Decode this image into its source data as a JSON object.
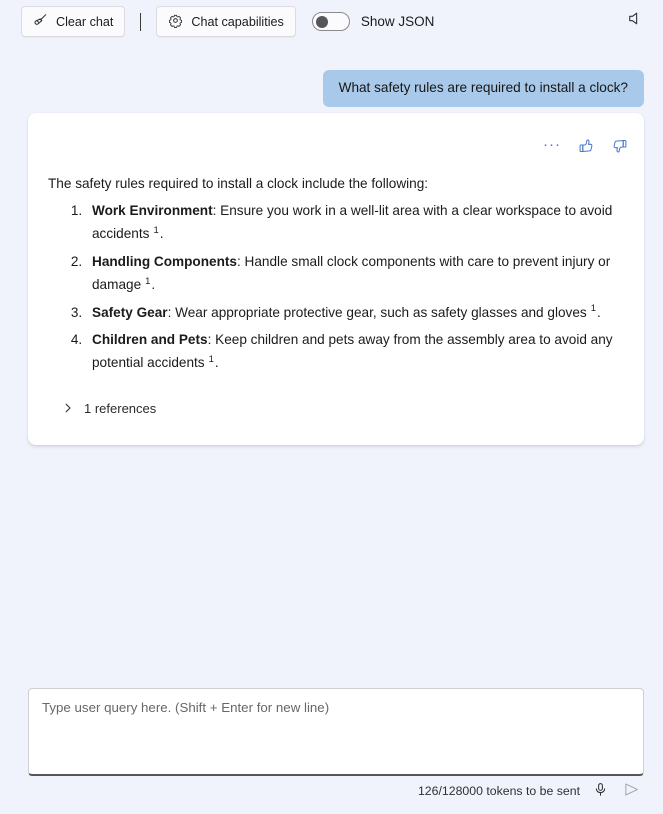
{
  "toolbar": {
    "clear_chat_label": "Clear chat",
    "clear_chat_icon": "broom-icon",
    "chat_capabilities_label": "Chat capabilities",
    "chat_capabilities_icon": "gear-icon",
    "show_json_label": "Show JSON",
    "show_json_enabled": false,
    "speaker_icon": "speaker-mute-icon"
  },
  "conversation": {
    "user_message": "What safety rules are required to install a clock?",
    "assistant": {
      "actions": {
        "more_label": "···",
        "thumbs_up_icon": "thumbs-up-icon",
        "thumbs_down_icon": "thumbs-down-icon"
      },
      "intro": "The safety rules required to install a clock include the following:",
      "items": [
        {
          "term": "Work Environment",
          "separator": ":",
          "text": " Ensure you work in a well-lit area with a clear workspace to avoid accidents",
          "citation": "1",
          "tail": "."
        },
        {
          "term": "Handling Components",
          "separator": ":",
          "text": " Handle small clock components with care to prevent injury or damage",
          "citation": "1",
          "tail": "."
        },
        {
          "term": "Safety Gear",
          "separator": ":",
          "text": " Wear appropriate protective gear, such as safety glasses and gloves",
          "citation": "1",
          "tail": "."
        },
        {
          "term": "Children and Pets",
          "separator": ":",
          "text": " Keep children and pets away from the assembly area to avoid any potential accidents",
          "citation": "1",
          "tail": "."
        }
      ],
      "references_label": "1 references",
      "references_expanded": false
    }
  },
  "composer": {
    "placeholder": "Type user query here. (Shift + Enter for new line)",
    "value": ""
  },
  "status": {
    "token_count": "126/128000 tokens to be sent",
    "mic_icon": "microphone-icon",
    "send_icon": "send-icon"
  },
  "colors": {
    "background": "#f1f3fc",
    "user_bubble": "#a9c9ea",
    "card": "#ffffff",
    "accent": "#4a79c8"
  }
}
